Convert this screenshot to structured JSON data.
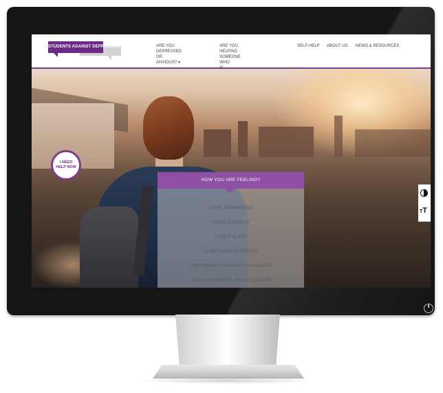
{
  "site": {
    "logo_text": "STUDENTS AGAINST DEPRESSION",
    "nav": [
      {
        "label": "ARE YOU DEPRESSED OR\nANXIOUS? ▾"
      },
      {
        "label": "ARE YOU HELPING SOMEONE WHO\nIS DEPRESSED OR ANXIOUS?"
      },
      {
        "label": "SELF-HELP"
      },
      {
        "label": "ABOUT US"
      },
      {
        "label": "NEWS & RESOURCES"
      }
    ]
  },
  "help_badge": {
    "label": "I NEED\nHELP NOW"
  },
  "feeling_panel": {
    "title": "HOW YOU ARE FEELING?",
    "options": [
      "I FEEL DEPRESSED",
      "I FEEL ANXIOUS",
      "I CAN'T SLEEP",
      "I CAN'T CONCENTRATE",
      "I AM HAVING STRANGE THOUGHTS",
      "I AM CONCERNED ABOUT SUICIDE"
    ]
  },
  "side_tools": {
    "contrast_icon": "contrast-icon",
    "text_size_icon": "text-size-icon",
    "text_size_label": "TT"
  },
  "colors": {
    "brand_purple": "#6b2b84",
    "panel_header_purple": "#8e4fa4",
    "monitor_bezel": "#151515"
  }
}
